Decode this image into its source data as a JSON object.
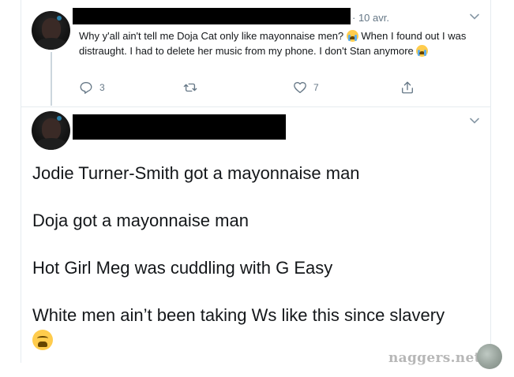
{
  "tweet1": {
    "date": "· 10 avr.",
    "text_part1": "Why y'all ain't tell me Doja Cat only like mayonnaise men? ",
    "text_part2": " When I found out I was distraught. I had to delete her music from my phone. I don't Stan anymore ",
    "emoji": "loudly-crying-face",
    "replies": "3",
    "retweets": "",
    "likes": "7"
  },
  "tweet2": {
    "handle_fragment": "@...",
    "lines": [
      "Jodie Turner-Smith got a mayonnaise  man",
      "Doja got a mayonnaise man",
      "Hot Girl Meg was cuddling with G Easy",
      "White men ain’t been taking Ws like this since slavery"
    ],
    "emoji": "weary-face"
  },
  "watermark": {
    "text": "naggers.net"
  },
  "icons": {
    "reply": "reply-icon",
    "retweet": "retweet-icon",
    "like": "heart-icon",
    "share": "share-icon",
    "menu": "chevron-down-icon"
  },
  "colors": {
    "secondary_text": "#657786",
    "border": "#e6ecf0",
    "thread_line": "#ccd6dd"
  }
}
